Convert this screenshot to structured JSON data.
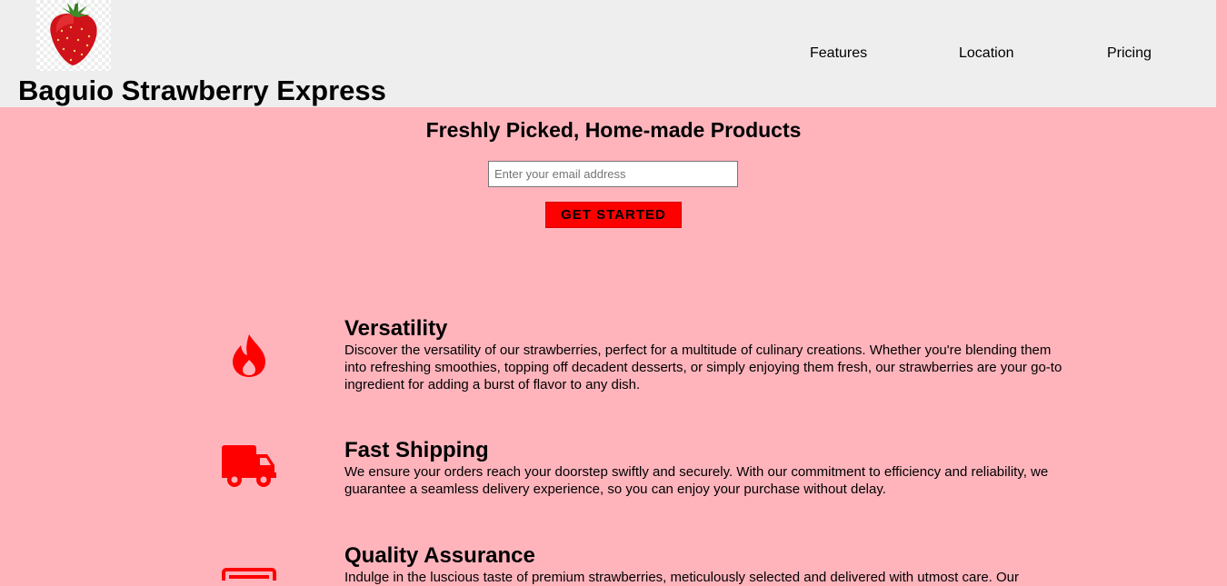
{
  "header": {
    "brand": "Baguio Strawberry Express",
    "nav": [
      "Features",
      "Location",
      "Pricing"
    ]
  },
  "hero": {
    "title": "Freshly Picked, Home-made Products",
    "email_placeholder": "Enter your email address",
    "cta_label": "GET STARTED"
  },
  "features": [
    {
      "icon": "fire-icon",
      "title": "Versatility",
      "text": "Discover the versatility of our strawberries, perfect for a multitude of culinary creations. Whether you're blending them into refreshing smoothies, topping off decadent desserts, or simply enjoying them fresh, our strawberries are your go-to ingredient for adding a burst of flavor to any dish."
    },
    {
      "icon": "truck-icon",
      "title": "Fast Shipping",
      "text": "We ensure your orders reach your doorstep swiftly and securely. With our commitment to efficiency and reliability, we guarantee a seamless delivery experience, so you can enjoy your purchase without delay."
    },
    {
      "icon": "badge-icon",
      "title": "Quality Assurance",
      "text": "Indulge in the luscious taste of premium strawberries, meticulously selected and delivered with utmost care. Our"
    }
  ],
  "colors": {
    "page_background": "#ffb4bc",
    "header_background": "#eeeeee",
    "accent": "#ff0000"
  }
}
